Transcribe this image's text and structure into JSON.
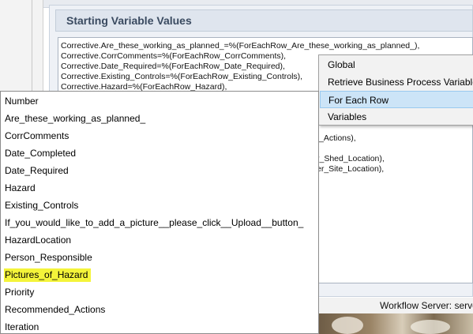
{
  "section": {
    "title": "Starting Variable Values"
  },
  "values_box": {
    "lines": [
      "Corrective.Are_these_working_as_planned_=%(ForEachRow_Are_these_working_as_planned_),",
      "Corrective.CorrComments=%(ForEachRow_CorrComments),",
      "Corrective.Date_Required=%(ForEachRow_Date_Required),",
      "Corrective.Existing_Controls=%(ForEachRow_Existing_Controls),",
      "Corrective.Hazard=%(ForEachRow_Hazard),"
    ],
    "partial_lines": [
      "_Actions),",
      "r_Shed_Location),",
      "er_Site_Location),"
    ]
  },
  "context_menu": {
    "items": [
      {
        "label": "Global",
        "highlighted": false
      },
      {
        "label": "Retrieve Business Process Variables",
        "highlighted": false
      },
      {
        "label": "For Each Row",
        "highlighted": true
      },
      {
        "label": "Variables",
        "highlighted": false
      }
    ]
  },
  "dropdown": {
    "options": [
      "Number",
      "Are_these_working_as_planned_",
      "CorrComments",
      "Date_Completed",
      "Date_Required",
      "Hazard",
      "Existing_Controls",
      "If_you_would_like_to_add_a_picture__please_click__Upload__button_",
      "HazardLocation",
      "Person_Responsible",
      "Pictures_of_Hazard",
      "Priority",
      "Recommended_Actions",
      "Iteration"
    ],
    "highlighted_option": "Pictures_of_Hazard",
    "highlight_color": "#f4f43a"
  },
  "status_bar": {
    "text": "Workflow Server: serve"
  },
  "colors": {
    "menu_highlight": "#cce4f7",
    "section_header_bg": "#dfe5ee",
    "section_title": "#3a4a60"
  }
}
